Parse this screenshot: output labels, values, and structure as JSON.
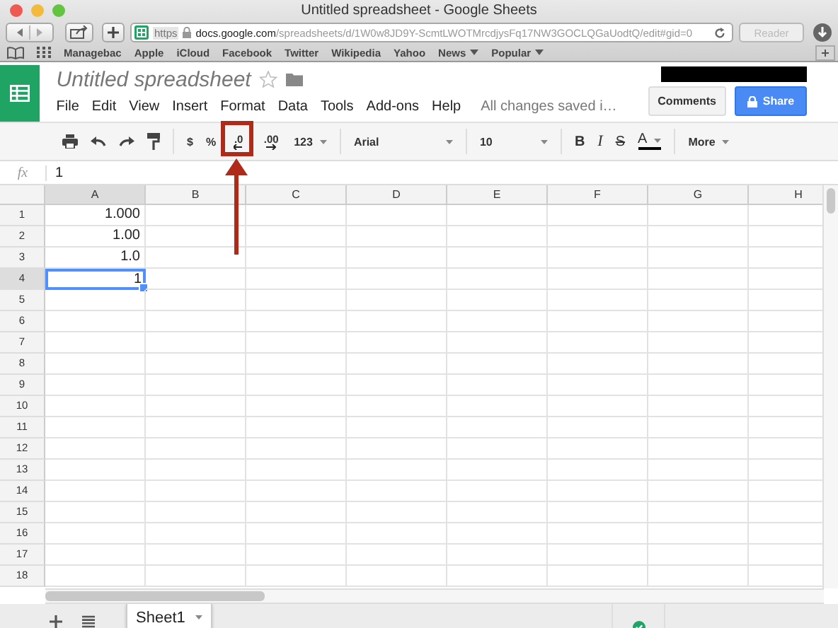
{
  "browser": {
    "title": "Untitled spreadsheet - Google Sheets",
    "https": "https",
    "url_host": "docs.google.com",
    "url_path": "/spreadsheets/d/1W0w8JD9Y-ScmtLWOTMrcdjysFq17NW3GOCLQGaUodtQ/edit#gid=0",
    "reader": "Reader",
    "bookmarks": [
      {
        "label": "Managebac",
        "menu": false
      },
      {
        "label": "Apple",
        "menu": false
      },
      {
        "label": "iCloud",
        "menu": false
      },
      {
        "label": "Facebook",
        "menu": false
      },
      {
        "label": "Twitter",
        "menu": false
      },
      {
        "label": "Wikipedia",
        "menu": false
      },
      {
        "label": "Yahoo",
        "menu": false
      },
      {
        "label": "News",
        "menu": true
      },
      {
        "label": "Popular",
        "menu": true
      }
    ]
  },
  "doc": {
    "title": "Untitled spreadsheet",
    "menu": [
      "File",
      "Edit",
      "View",
      "Insert",
      "Format",
      "Data",
      "Tools",
      "Add-ons",
      "Help"
    ],
    "status": "All changes saved i…",
    "comments": "Comments",
    "share": "Share"
  },
  "toolbar": {
    "currency": "$",
    "percent": "%",
    "decrease_decimal": ".0",
    "increase_decimal": ".00",
    "number_format": "123",
    "font": "Arial",
    "font_size": "10",
    "bold": "B",
    "italic": "I",
    "strikethrough": "S",
    "text_color": "A",
    "more": "More"
  },
  "formula_bar": {
    "label": "fx",
    "value": "1"
  },
  "grid": {
    "columns": [
      "A",
      "B",
      "C",
      "D",
      "E",
      "F",
      "G",
      "H"
    ],
    "rows": [
      {
        "label": "1",
        "value": "1.000",
        "selected": false
      },
      {
        "label": "2",
        "value": "1.00",
        "selected": false
      },
      {
        "label": "3",
        "value": "1.0",
        "selected": false
      },
      {
        "label": "4",
        "value": "1",
        "selected": true
      },
      {
        "label": "5",
        "selected": false
      },
      {
        "label": "6",
        "selected": false
      },
      {
        "label": "7",
        "selected": false
      },
      {
        "label": "8",
        "selected": false
      },
      {
        "label": "9",
        "selected": false
      },
      {
        "label": "10",
        "selected": false
      },
      {
        "label": "11",
        "selected": false
      },
      {
        "label": "12",
        "selected": false
      },
      {
        "label": "13",
        "selected": false
      },
      {
        "label": "14",
        "selected": false
      },
      {
        "label": "15",
        "selected": false
      },
      {
        "label": "16",
        "selected": false
      },
      {
        "label": "17",
        "selected": false
      },
      {
        "label": "18",
        "selected": false
      }
    ]
  },
  "sheets": [
    {
      "label": "Sheet1",
      "selected": true
    }
  ]
}
